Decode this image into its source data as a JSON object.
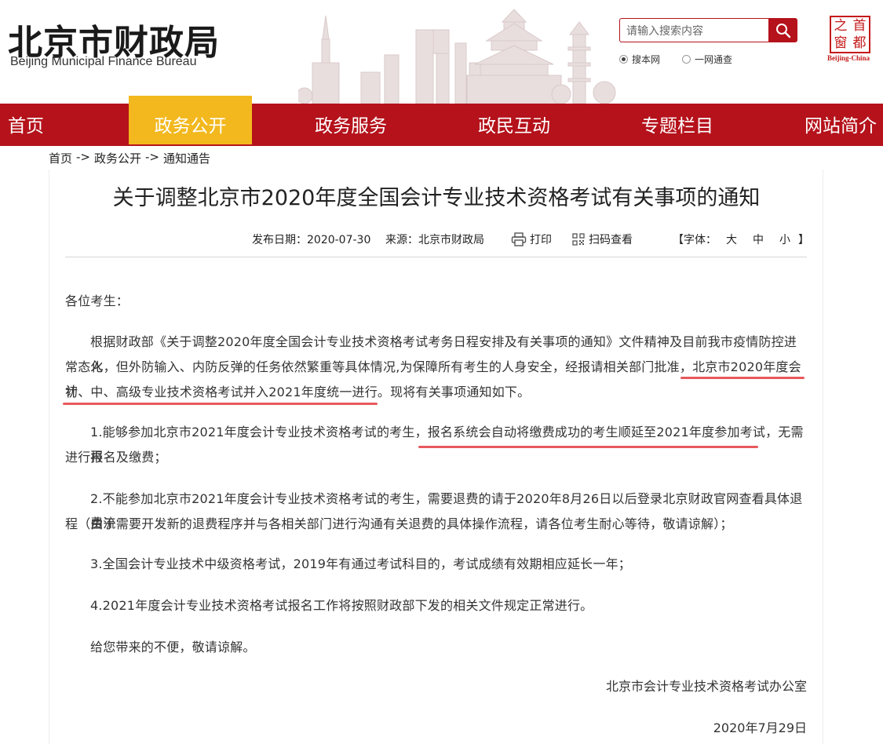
{
  "header": {
    "logo_cn": "北京市财政局",
    "logo_en": "Beijing Municipal Finance Bureau",
    "search_placeholder": "请输入搜索内容",
    "radio_site": "搜本网",
    "radio_all": "一网通查",
    "seal_chars": [
      "之",
      "首",
      "窗",
      "都"
    ],
    "seal_sub": "Beijing-China"
  },
  "nav": {
    "items": [
      "首页",
      "政务公开",
      "政务服务",
      "政民互动",
      "专题栏目",
      "网站简介"
    ],
    "active": "政务公开"
  },
  "breadcrumb": {
    "home": "首页",
    "sep1": "->",
    "section": "政务公开",
    "sep2": "->",
    "current": "通知通告"
  },
  "article": {
    "title": "关于调整北京市2020年度全国会计专业技术资格考试有关事项的通知",
    "publish_date": "发布日期：2020-07-30",
    "source": "来源：北京市财政局",
    "print": "打印",
    "scan": "扫码查看",
    "font_label": "【字体：",
    "font_large": "大",
    "font_medium": "中",
    "font_small": "小",
    "font_close": "】",
    "greeting": "各位考生：",
    "p1a": "根据财政部《关于调整2020年度全国会计专业技术资格考试考务日程安排及有关事项的通知》文件精神及目前我市疫情防控进入",
    "p1b": "常态化，但外防输入、内防反弹的任务依然繁重等具体情况,为保障所有考生的人身安全，经报请相关部门批准，北京市2020年度会计",
    "p1c": "初、中、高级专业技术资格考试并入2021年度统一进行。现将有关事项通知如下。",
    "p2a": "1.能够参加北京市2021年度会计专业技术资格考试的考生，报名系统会自动将缴费成功的考生顺延至2021年度参加考试，无需再",
    "p2b": "进行报名及缴费；",
    "p3a": "2.不能参加北京市2021年度会计专业技术资格考试的考生，需要退费的请于2020年8月26日以后登录北京财政官网查看具体退费流",
    "p3b": "程（由于需要开发新的退费程序并与各相关部门进行沟通有关退费的具体操作流程，请各位考生耐心等待，敬请谅解）；",
    "p4": "3.全国会计专业技术中级资格考试，2019年有通过考试科目的，考试成绩有效期相应延长一年；",
    "p5": "4.2021年度会计专业技术资格考试报名工作将按照财政部下发的相关文件规定正常进行。",
    "p6": "给您带来的不便，敬请谅解。",
    "signature": "北京市会计专业技术资格考试办公室",
    "sign_date": "2020年7月29日"
  },
  "colors": {
    "brand_red": "#b5121b",
    "nav_active": "#f2b81e",
    "highlight_underline": "#e8595d"
  }
}
